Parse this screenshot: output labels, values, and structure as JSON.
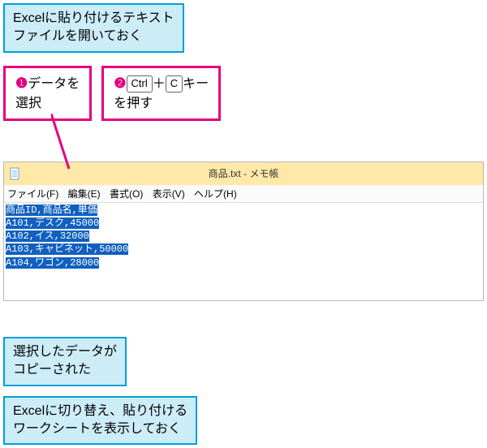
{
  "callout_top": {
    "line1": "Excelに貼り付けるテキスト",
    "line2": "ファイルを開いておく"
  },
  "step1": {
    "num": "❶",
    "line1_rest": "データを",
    "line2": "選択"
  },
  "step2": {
    "num": "❷",
    "key1": "Ctrl",
    "plus": "＋",
    "key2": "C",
    "rest1": "キー",
    "line2": "を押す"
  },
  "window": {
    "title": "商品.txt - メモ帳",
    "menu": {
      "file": "ファイル(F)",
      "edit": "編集(E)",
      "format": "書式(O)",
      "view": "表示(V)",
      "help": "ヘルプ(H)"
    },
    "content": {
      "l1": "商品ID,商品名,単価",
      "l2": "A101,デスク,45000",
      "l3": "A102,イス,32000",
      "l4": "A103,キャビネット,50000",
      "l5": "A104,ワゴン,28000"
    }
  },
  "callout_mid": {
    "line1": "選択したデータが",
    "line2": "コピーされた"
  },
  "callout_bottom": {
    "line1": "Excelに切り替え、貼り付ける",
    "line2": "ワークシートを表示しておく"
  }
}
